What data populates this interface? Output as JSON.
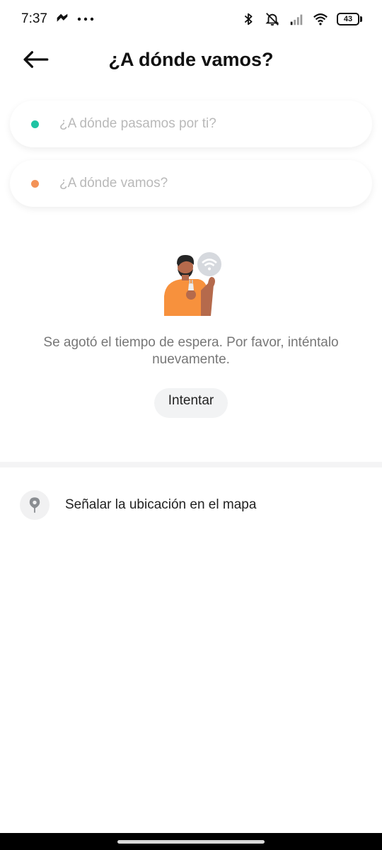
{
  "status_bar": {
    "time": "7:37",
    "battery": "43",
    "icons": [
      "app-notification-icon",
      "more-dots-icon",
      "bluetooth-icon",
      "muted-bell-icon",
      "signal-icon",
      "wifi-icon",
      "battery-icon"
    ]
  },
  "header": {
    "title": "¿A dónde vamos?",
    "back_icon": "back-arrow-icon"
  },
  "pickup": {
    "placeholder": "¿A dónde pasamos por ti?",
    "dot_color": "#1fc3a3"
  },
  "destination": {
    "placeholder": "¿A dónde vamos?",
    "dot_color": "#f39257"
  },
  "error": {
    "message": "Se agotó el tiempo de espera. Por favor, inténtalo nuevamente.",
    "illustration": "no-connection-illustration"
  },
  "retry": {
    "label": "Intentar"
  },
  "map_option": {
    "label": "Señalar la ubicación en el mapa",
    "icon": "map-pin-icon"
  },
  "colors": {
    "accent_orange": "#f7913d",
    "pickup_green": "#1fc3a3",
    "destination_orange": "#f39257",
    "text_muted": "#777777"
  }
}
